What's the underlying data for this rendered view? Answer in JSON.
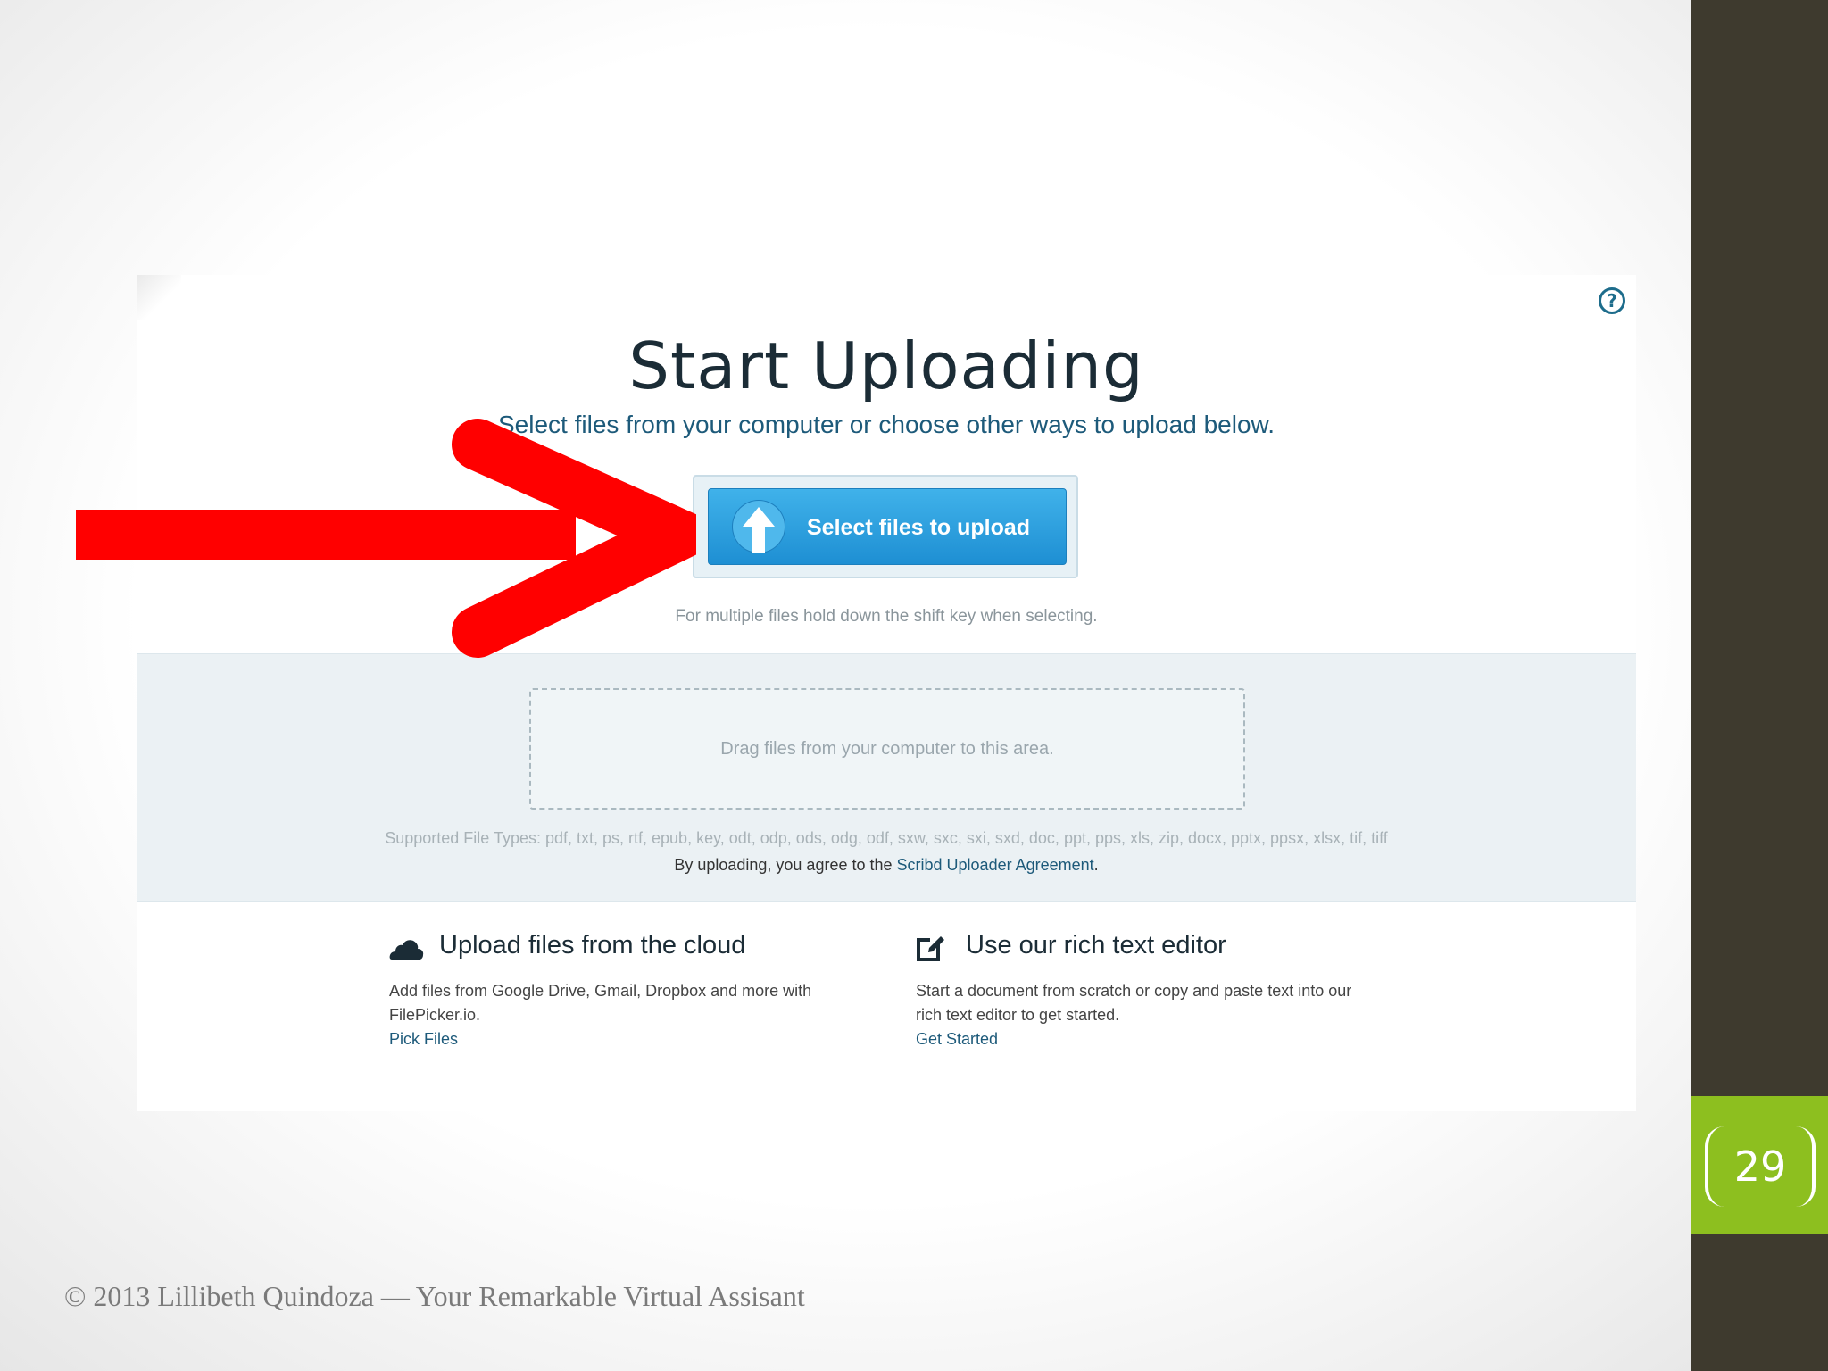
{
  "slide": {
    "page_number": "29",
    "footer": "© 2013 Lillibeth Quindoza  — Your Remarkable Virtual Assisant"
  },
  "upload_page": {
    "title": "Start Uploading",
    "subtitle": "Select files from your computer or choose other ways to upload below.",
    "upload_button_label": "Select files to upload",
    "hint": "For multiple files hold down the shift key when selecting.",
    "drop_zone_text": "Drag files from your computer to this area.",
    "supported_types": "Supported File Types: pdf, txt, ps, rtf, epub, key, odt, odp, ods, odg, odf, sxw, sxc, sxi, sxd, doc, ppt, pps, xls, zip, docx, pptx, ppsx, xlsx, tif, tiff",
    "agreement_prefix": "By uploading, you agree to the ",
    "agreement_link": "Scribd Uploader Agreement",
    "agreement_suffix": ".",
    "help_icon_glyph": "?",
    "options": [
      {
        "icon": "cloud-icon",
        "title": "Upload files from the cloud",
        "description": "Add files from Google Drive, Gmail, Dropbox and more with FilePicker.io.",
        "link": "Pick Files"
      },
      {
        "icon": "edit-icon",
        "title": "Use our rich text editor",
        "description": "Start a document from scratch or copy and paste text into our rich text editor to get started.",
        "link": "Get Started"
      }
    ]
  },
  "colors": {
    "accent_blue": "#1e8fd3",
    "sidebar": "#3e3a2e",
    "page_number_box": "#8dbf1f",
    "arrow": "#ff0000"
  }
}
